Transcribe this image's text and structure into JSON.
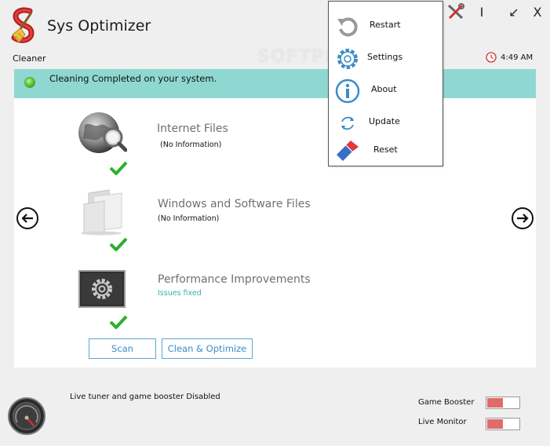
{
  "window": {
    "title": "Sys Optimizer",
    "controls": {
      "minimize": "I",
      "restore": "↙",
      "close": "X"
    }
  },
  "section_label": "Cleaner",
  "clock": {
    "time": "4:49 AM"
  },
  "status": {
    "text": "Cleaning Completed on your system."
  },
  "watermark": "SOFTPEDIA",
  "items": [
    {
      "title": "Internet Files",
      "subtitle": "(No Information)",
      "icon": "globe-search-icon"
    },
    {
      "title": "Windows and Software Files",
      "subtitle": "(No Information)",
      "icon": "folder-icon"
    },
    {
      "title": "Performance Improvements",
      "subtitle": "Issues fixed",
      "icon": "gear-monitor-icon"
    }
  ],
  "buttons": {
    "scan": "Scan",
    "clean_optimize": "Clean & Optimize"
  },
  "footer": {
    "status_text": "Live tuner and game booster Disabled",
    "toggles": [
      {
        "label": "Game Booster",
        "fill": 0.5
      },
      {
        "label": "Live Monitor",
        "fill": 0.5
      }
    ]
  },
  "menu": {
    "items": [
      {
        "label": "Restart",
        "icon": "restart-icon"
      },
      {
        "label": "Settings",
        "icon": "settings-gear-icon"
      },
      {
        "label": "About",
        "icon": "info-icon"
      },
      {
        "label": "Update",
        "icon": "update-icon"
      },
      {
        "label": "Reset",
        "icon": "eraser-icon"
      }
    ]
  },
  "colors": {
    "status_bar": "#8fd8d2",
    "accent_blue": "#3a8cc8",
    "check_green": "#2bb02b",
    "toggle_red": "#e06b6b",
    "issues_fixed": "#3ab0a8"
  }
}
